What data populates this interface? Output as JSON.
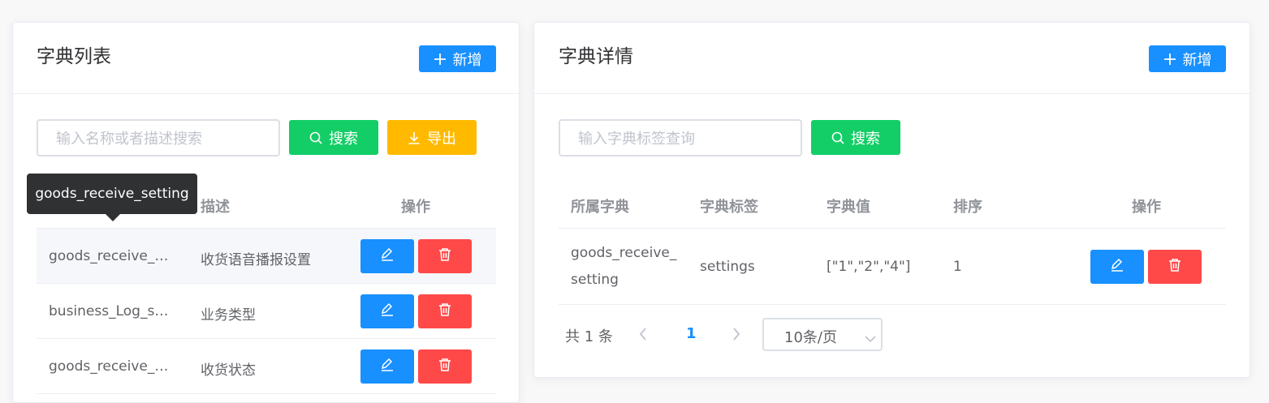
{
  "left_panel": {
    "title": "字典列表",
    "add_label": "新增",
    "search_placeholder": "输入名称或者描述搜索",
    "search_label": "搜索",
    "export_label": "导出",
    "columns": [
      "描述",
      "操作"
    ],
    "tooltip": "goods_receive_setting",
    "rows": [
      {
        "name": "goods_receive_…",
        "desc": "收货语音播报设置"
      },
      {
        "name": "business_Log_s…",
        "desc": "业务类型"
      },
      {
        "name": "goods_receive_…",
        "desc": "收货状态"
      }
    ]
  },
  "right_panel": {
    "title": "字典详情",
    "add_label": "新增",
    "search_placeholder": "输入字典标签查询",
    "search_label": "搜索",
    "columns": [
      "所属字典",
      "字典标签",
      "字典值",
      "排序",
      "操作"
    ],
    "rows": [
      {
        "dict_line1": "goods_receive_",
        "dict_line2": "setting",
        "label": "settings",
        "value": "[\"1\",\"2\",\"4\"]",
        "sort": "1"
      }
    ],
    "pagination": {
      "total": "共 1 条",
      "current_page": "1",
      "page_size": "10条/页"
    }
  },
  "icons": {
    "plus": "plus-icon",
    "search": "search-icon",
    "download": "download-icon",
    "edit": "edit-icon",
    "delete": "trash-icon",
    "prev": "chevron-left-icon",
    "next": "chevron-right-icon",
    "dropdown": "chevron-down-icon"
  },
  "colors": {
    "primary": "#1890ff",
    "success": "#13ce66",
    "warning": "#ffba00",
    "danger": "#ff4949"
  }
}
